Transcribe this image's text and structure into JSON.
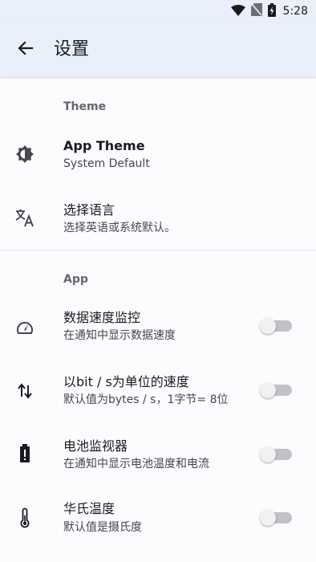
{
  "status_bar": {
    "time": "5:28",
    "icons": [
      "wifi-icon",
      "no-sim-icon",
      "battery-charging-icon"
    ]
  },
  "app_bar": {
    "back_icon": "arrow-back-icon",
    "title": "设置"
  },
  "sections": {
    "theme": {
      "header": "Theme",
      "app_theme": {
        "icon": "brightness-icon",
        "title": "App Theme",
        "subtitle": "System Default"
      },
      "language": {
        "icon": "translate-icon",
        "title": "选择语言",
        "subtitle": "选择英语或系统默认。"
      }
    },
    "app": {
      "header": "App",
      "data_speed": {
        "icon": "speedometer-icon",
        "title": "数据速度监控",
        "subtitle": "在通知中显示数据速度",
        "enabled": false
      },
      "bit_speed": {
        "icon": "swap-vertical-icon",
        "title": "以bit / s为单位的速度",
        "subtitle": "默认值为bytes / s，1字节= 8位",
        "enabled": false
      },
      "battery_monitor": {
        "icon": "battery-alert-icon",
        "title": " 电池监视器",
        "subtitle": "在通知中显示电池温度和电流",
        "enabled": false
      },
      "fahrenheit": {
        "icon": "thermometer-icon",
        "title": "华氏温度",
        "subtitle": "默认值是摄氏度",
        "enabled": false
      }
    }
  }
}
